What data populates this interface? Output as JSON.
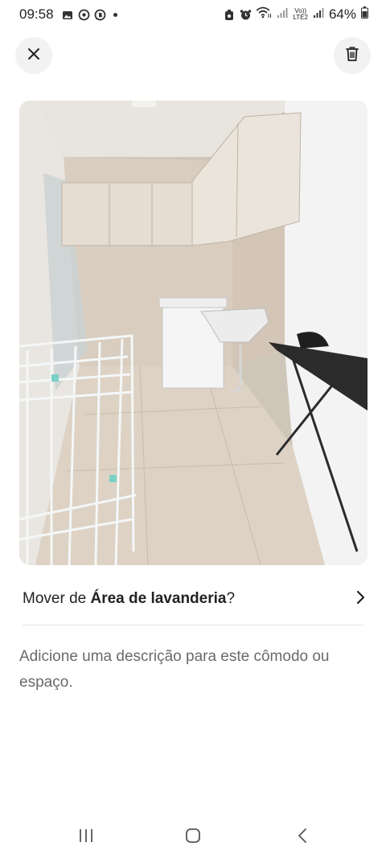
{
  "status_bar": {
    "time": "09:58",
    "left_icons": [
      "gallery-icon",
      "whatsapp-icon",
      "whatsapp-business-icon"
    ],
    "right_icons": [
      "alarm-icon",
      "wifi-icon",
      "signal-icon",
      "volte-icon",
      "battery-icon"
    ],
    "volte_line1": "Vo))",
    "volte_line2": "LTE2",
    "battery": "64%"
  },
  "header": {
    "close_icon": "close-icon",
    "delete_icon": "trash-icon"
  },
  "photo": {
    "subject": "laundry-room-photo"
  },
  "move_row": {
    "prefix": "Mover de ",
    "room": "Área de lavanderia",
    "suffix": "?",
    "chevron": "chevron-right-icon"
  },
  "description": {
    "placeholder": "Adicione uma descrição para este cômodo ou espaço."
  },
  "nav_bar": {
    "recents_icon": "recents-icon",
    "home_icon": "home-icon",
    "back_icon": "back-icon"
  }
}
